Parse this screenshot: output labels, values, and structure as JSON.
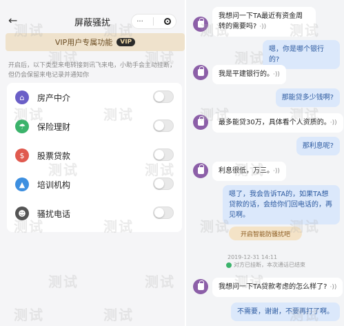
{
  "left": {
    "back_glyph": "←",
    "title": "屏蔽骚扰",
    "capsule_more": "···",
    "vip_text": "VIP用户专属功能",
    "vip_badge": "VIP",
    "hint": "开启后，以下类型来电转接到讯飞来电，小助手会主动挂断，但仍会保留来电记录并通知你",
    "items": [
      {
        "label": "房产中介",
        "icon": "house-icon",
        "color": "#6b5fc7",
        "glyph": "⌂"
      },
      {
        "label": "保险理财",
        "icon": "umbrella-icon",
        "color": "#3bb36b",
        "glyph": "☂"
      },
      {
        "label": "股票贷款",
        "icon": "moneybag-icon",
        "color": "#e05a4f",
        "glyph": "$"
      },
      {
        "label": "培训机构",
        "icon": "graduation-cap-icon",
        "color": "#3d8fe0",
        "glyph": "▲"
      },
      {
        "label": "骚扰电话",
        "icon": "robot-icon",
        "color": "#555555",
        "glyph": "☻"
      }
    ]
  },
  "right": {
    "speaker_glyph": "·))",
    "messages": [
      {
        "dir": "in",
        "text": "我想问一下TA最近有资金周转的需要吗?"
      },
      {
        "dir": "out",
        "text": "嗯，你是哪个银行的?"
      },
      {
        "dir": "in",
        "text": "我是平建银行的。"
      },
      {
        "dir": "out",
        "text": "那能贷多少钱啊?"
      },
      {
        "dir": "in",
        "text": "最多能贷30万，具体看个人资质的。"
      },
      {
        "dir": "out",
        "text": "那利息呢?"
      },
      {
        "dir": "in",
        "text": "利息很低，万三。"
      },
      {
        "dir": "out",
        "text": "嗯了，我会告诉TA的，如果TA想贷款的话，会给你们回电话的，再见啊。"
      },
      {
        "dir": "in",
        "text": "我想问一下TA贷款考虑的怎么样了?"
      },
      {
        "dir": "out",
        "text": "不需要，谢谢，不要再打了啊。"
      }
    ],
    "anti_button": "开启智能防骚扰吧",
    "timestamp": "2019-12-31 14:11",
    "status_text": "对方已挂断，本次通话已结束"
  },
  "watermark": "测试"
}
